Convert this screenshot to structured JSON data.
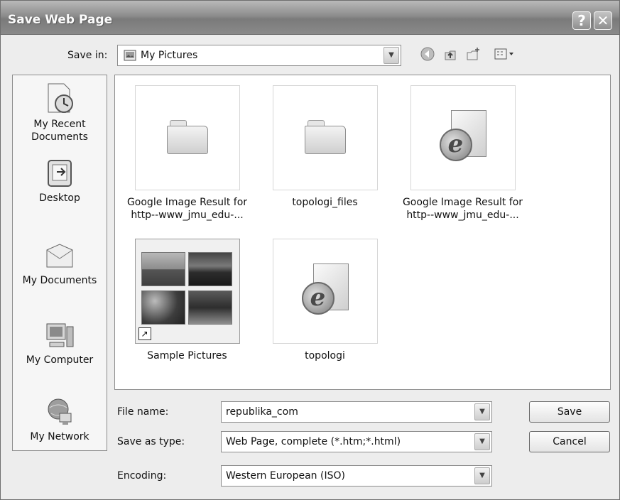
{
  "window": {
    "title": "Save Web Page",
    "help": "?",
    "close": "✕"
  },
  "toolbar": {
    "save_in_label": "Save in:",
    "location": "My Pictures",
    "icons": [
      "back-icon",
      "up-folder-icon",
      "new-folder-icon",
      "views-menu-icon"
    ]
  },
  "places": [
    {
      "label": "My Recent Documents",
      "icon": "recent-documents-icon"
    },
    {
      "label": "Desktop",
      "icon": "desktop-icon"
    },
    {
      "label": "My Documents",
      "icon": "my-documents-icon"
    },
    {
      "label": "My Computer",
      "icon": "my-computer-icon"
    },
    {
      "label": "My Network",
      "icon": "my-network-icon"
    }
  ],
  "files": [
    {
      "line1": "Google Image Result for",
      "line2": "http--www_jmu_edu-...",
      "type": "folder"
    },
    {
      "line1": "topologi_files",
      "line2": "",
      "type": "folder"
    },
    {
      "line1": "Google Image Result for",
      "line2": "http--www_jmu_edu-...",
      "type": "html"
    },
    {
      "line1": "Sample Pictures",
      "line2": "",
      "type": "shortcut-folder"
    },
    {
      "line1": "topologi",
      "line2": "",
      "type": "html"
    }
  ],
  "form": {
    "file_name_label": "File name:",
    "file_name_value": "republika_com",
    "save_as_type_label": "Save as type:",
    "save_as_type_value": "Web Page, complete (*.htm;*.html)",
    "encoding_label": "Encoding:",
    "encoding_value": "Western European (ISO)"
  },
  "buttons": {
    "save": "Save",
    "cancel": "Cancel"
  }
}
